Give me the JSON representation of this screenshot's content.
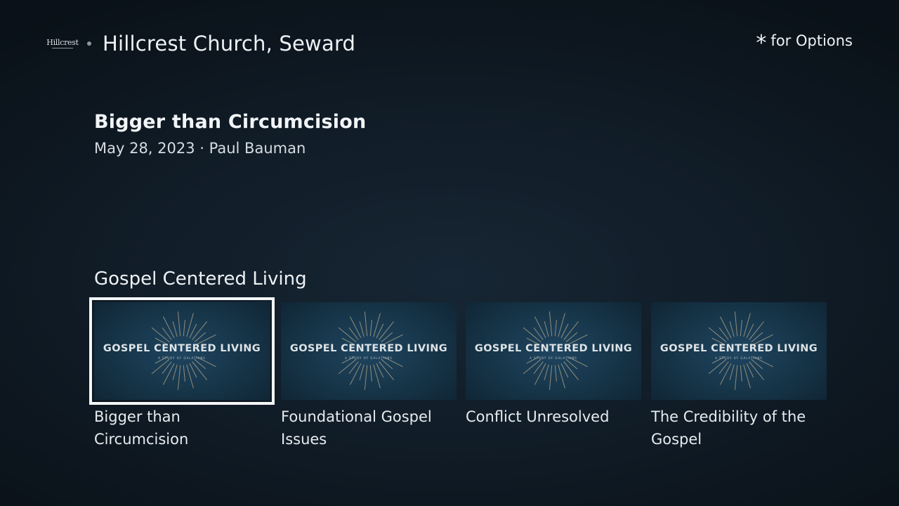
{
  "header": {
    "logo_text": "Hillcrest",
    "app_title": "Hillcrest Church, Seward",
    "options_glyph": "*",
    "options_label": "for Options"
  },
  "detail": {
    "title": "Bigger than Circumcision",
    "meta": "May 28, 2023 · Paul Bauman"
  },
  "row": {
    "title": "Gospel Centered Living",
    "focused_index": 0,
    "items": [
      {
        "thumb_title": "GOSPEL CENTERED LIVING",
        "thumb_sub": "A STUDY OF GALATIANS",
        "label": "Bigger than Circumcision"
      },
      {
        "thumb_title": "GOSPEL CENTERED LIVING",
        "thumb_sub": "A STUDY OF GALATIANS",
        "label": "Foundational Gospel Issues"
      },
      {
        "thumb_title": "GOSPEL CENTERED LIVING",
        "thumb_sub": "A STUDY OF GALATIANS",
        "label": "Conflict Unresolved"
      },
      {
        "thumb_title": "GOSPEL CENTERED LIVING",
        "thumb_sub": "A STUDY OF GALATIANS",
        "label": "The Credibility of the Gospel"
      }
    ]
  },
  "colors": {
    "background": "#111d28",
    "thumb_background": "#163447",
    "focus_outline": "#f4f6f7",
    "ray_color": "#b8a98a"
  }
}
